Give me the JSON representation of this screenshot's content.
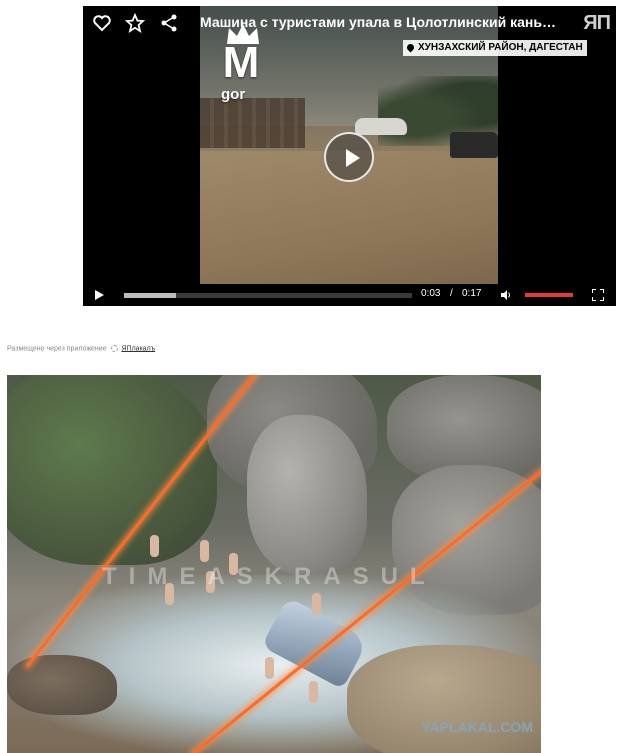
{
  "player": {
    "title": "Машина с туристами упала в Цолотлинский каньон Даг…",
    "channel_mark": "ЯП",
    "location": "ХУНЗАХСКИЙ РАЙОН, ДАГЕСТАН",
    "logo_letter": "M",
    "logo_text": "gor",
    "time_current": "0:03",
    "time_separator": "/",
    "time_total": "0:17",
    "progress": 0.18,
    "volume": 1.0,
    "icons": [
      "heart-icon",
      "star-icon",
      "share-icon",
      "play-icon",
      "volume-icon",
      "fullscreen-icon"
    ]
  },
  "posted": {
    "text": "Размещено через приложение",
    "app_name": "ЯПлакалъ"
  },
  "photo": {
    "watermark": "TIMEASKRASUL",
    "site_mark": "YAPLAKAL.COM"
  },
  "colors": {
    "accent_red": "#e53935",
    "laser": "#ff6a2a",
    "site_mark": "#8aa2b7"
  }
}
